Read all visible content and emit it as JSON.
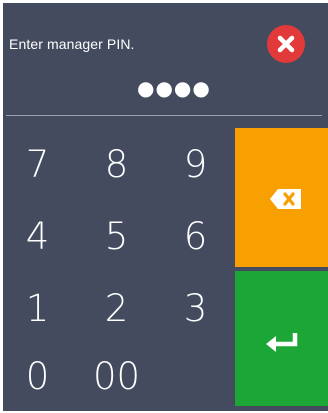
{
  "prompt": "Enter manager PIN.",
  "pin_mask": "●●●●",
  "keys": {
    "k7": "7",
    "k8": "8",
    "k9": "9",
    "k4": "4",
    "k5": "5",
    "k6": "6",
    "k1": "1",
    "k2": "2",
    "k3": "3",
    "k0": "0",
    "k00": "00"
  },
  "colors": {
    "panel": "#444b5f",
    "close": "#e2393a",
    "backspace": "#f8a001",
    "enter": "#1ca636"
  },
  "icons": {
    "close": "close-icon",
    "backspace": "backspace-icon",
    "enter": "enter-icon"
  }
}
